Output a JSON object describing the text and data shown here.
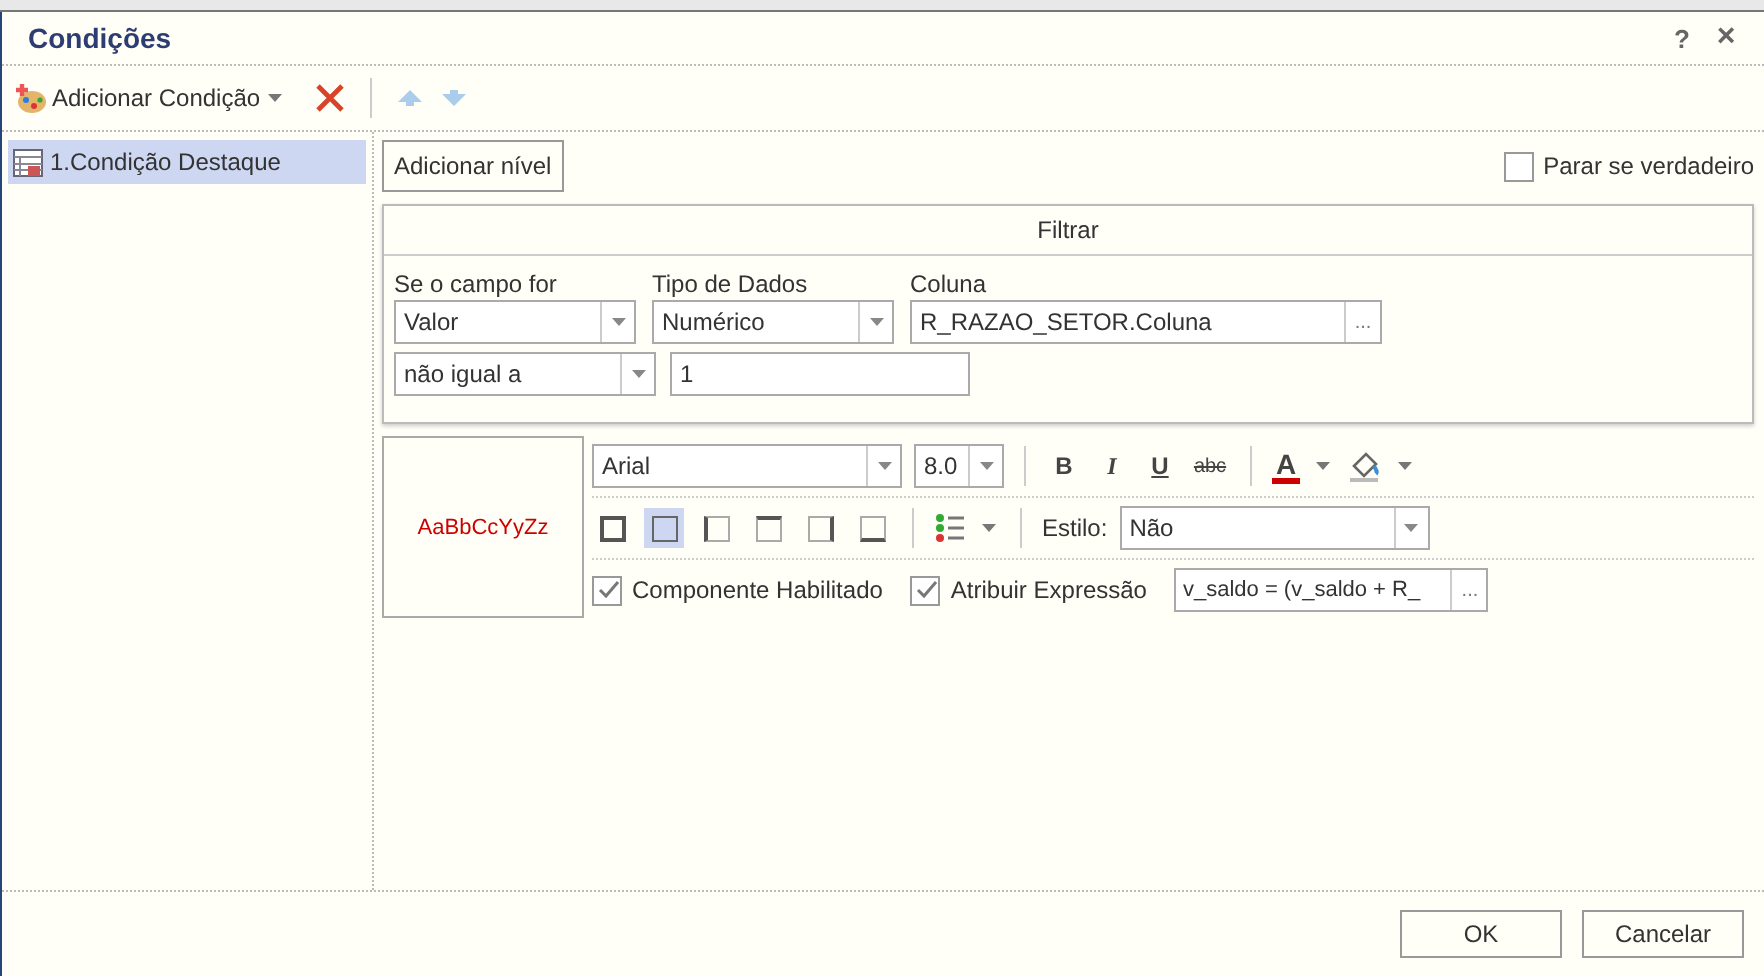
{
  "window": {
    "title": "Condições",
    "help": "?",
    "close": "×"
  },
  "toolbar": {
    "add_label": "Adicionar Condição"
  },
  "conditions": [
    {
      "label": "1.Condição Destaque",
      "selected": true
    }
  ],
  "add_level": "Adicionar nível",
  "stop_if_true": {
    "label": "Parar se verdadeiro",
    "checked": false
  },
  "filter": {
    "title": "Filtrar",
    "field_label": "Se o campo for",
    "field_value": "Valor",
    "type_label": "Tipo de Dados",
    "type_value": "Numérico",
    "column_label": "Coluna",
    "column_value": "R_RAZAO_SETOR.Coluna",
    "column_button": "...",
    "operator": "não igual a",
    "value": "1"
  },
  "format": {
    "preview": "AaBbCcYyZz",
    "font": "Arial",
    "size": "8.0",
    "bold": "B",
    "italic": "I",
    "underline": "U",
    "strike": "abc",
    "font_color": "A",
    "borders": [
      {
        "kind": "all",
        "selected": false
      },
      {
        "kind": "outside",
        "selected": true
      },
      {
        "kind": "left",
        "selected": false
      },
      {
        "kind": "top",
        "selected": false
      },
      {
        "kind": "right",
        "selected": false
      },
      {
        "kind": "bottom",
        "selected": false
      }
    ],
    "style_label": "Estilo:",
    "style_value": "Não",
    "enabled": {
      "label": "Componente Habilitado",
      "checked": true
    },
    "assign": {
      "label": "Atribuir Expressão",
      "checked": true
    },
    "expression": "v_saldo = (v_saldo + R_",
    "expression_button": "..."
  },
  "buttons": [
    {
      "label": "OK"
    },
    {
      "label": "Cancelar"
    }
  ]
}
